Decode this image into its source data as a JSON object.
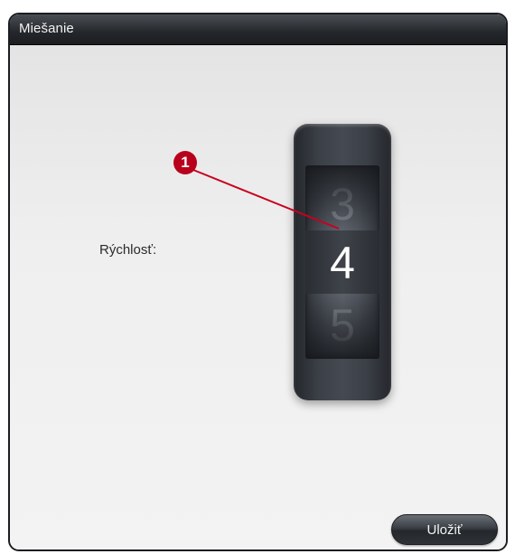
{
  "dialog": {
    "title": "Miešanie"
  },
  "speed": {
    "label": "Rýchlosť:",
    "previous_value": "3",
    "current_value": "4",
    "next_value": "5"
  },
  "callout": {
    "number": "1",
    "color": "#b8001c"
  },
  "actions": {
    "save_label": "Uložiť"
  }
}
